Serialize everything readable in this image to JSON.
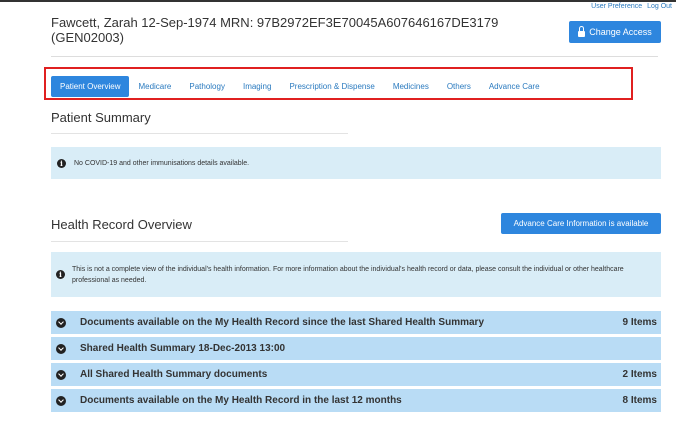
{
  "top_links": {
    "preference": "User Preference",
    "logout": "Log Out"
  },
  "patient": {
    "name_line": "Fawcett, Zarah 12-Sep-1974 MRN: 97B2972EF3E70045A607646167DE3179 (GEN02003)"
  },
  "change_access_label": "Change Access",
  "tabs": [
    {
      "label": "Patient Overview",
      "active": true
    },
    {
      "label": "Medicare"
    },
    {
      "label": "Pathology"
    },
    {
      "label": "Imaging"
    },
    {
      "label": "Prescription & Dispense"
    },
    {
      "label": "Medicines"
    },
    {
      "label": "Others"
    },
    {
      "label": "Advance Care"
    }
  ],
  "patient_summary": {
    "title": "Patient Summary",
    "alert": "No COVID-19 and other immunisations details available."
  },
  "health_record": {
    "title": "Health Record Overview",
    "advance_care_button": "Advance Care Information is available",
    "alert": "This is not a complete view of the individual's health information. For more information about the individual's health record or data, please consult the individual or other healthcare professional as needed."
  },
  "record_rows": [
    {
      "label": "Documents available on the My Health Record since the last Shared Health Summary",
      "count": "9 Items"
    },
    {
      "label": "Shared Health Summary 18-Dec-2013 13:00",
      "count": ""
    },
    {
      "label": "All Shared Health Summary documents",
      "count": "2 Items"
    },
    {
      "label": "Documents available on the My Health Record in the last 12 months",
      "count": "8 Items"
    }
  ],
  "colors": {
    "accent": "#2e86de",
    "alert_bg": "#d9edf7",
    "row_bg": "#b9dcf5",
    "highlight": "#e02020"
  },
  "icons": {
    "access": "lock-icon",
    "info": "info-icon",
    "expand": "chevron-circle-icon"
  }
}
